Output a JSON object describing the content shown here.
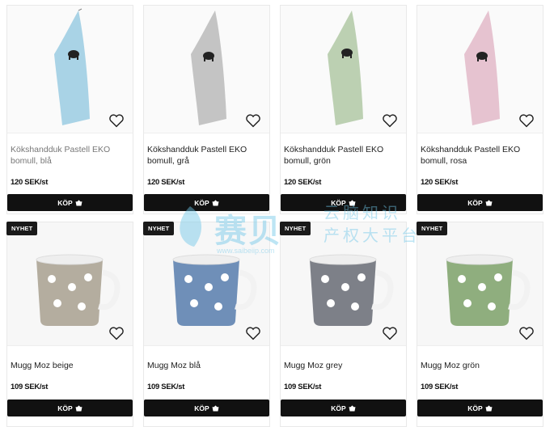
{
  "products": [
    {
      "name": "Kökshandduk Pastell EKO bomull, blå",
      "price": "120 SEK/st",
      "buy_label": "KÖP",
      "badge": "",
      "kind": "towel",
      "color": "#a9d3e6"
    },
    {
      "name": "Kökshandduk Pastell EKO bomull, grå",
      "price": "120 SEK/st",
      "buy_label": "KÖP",
      "badge": "",
      "kind": "towel",
      "color": "#c4c4c4"
    },
    {
      "name": "Kökshandduk Pastell EKO bomull, grön",
      "price": "120 SEK/st",
      "buy_label": "KÖP",
      "badge": "",
      "kind": "towel",
      "color": "#bcd0b2"
    },
    {
      "name": "Kökshandduk Pastell EKO bomull, rosa",
      "price": "120 SEK/st",
      "buy_label": "KÖP",
      "badge": "",
      "kind": "towel",
      "color": "#e6c3d0"
    },
    {
      "name": "Mugg Moz beige",
      "price": "109 SEK/st",
      "buy_label": "KÖP",
      "badge": "NYHET",
      "kind": "mug",
      "color": "#b4ad9f"
    },
    {
      "name": "Mugg Moz blå",
      "price": "109 SEK/st",
      "buy_label": "KÖP",
      "badge": "NYHET",
      "kind": "mug",
      "color": "#6f8fb8"
    },
    {
      "name": "Mugg Moz grey",
      "price": "109 SEK/st",
      "buy_label": "KÖP",
      "badge": "NYHET",
      "kind": "mug",
      "color": "#7d8088"
    },
    {
      "name": "Mugg Moz grön",
      "price": "109 SEK/st",
      "buy_label": "KÖP",
      "badge": "NYHET",
      "kind": "mug",
      "color": "#8fae7e"
    }
  ],
  "watermark": {
    "big": "赛贝",
    "small1": "云脑知识",
    "small2": "产权大平台",
    "url": "www.saibeiip.com"
  }
}
